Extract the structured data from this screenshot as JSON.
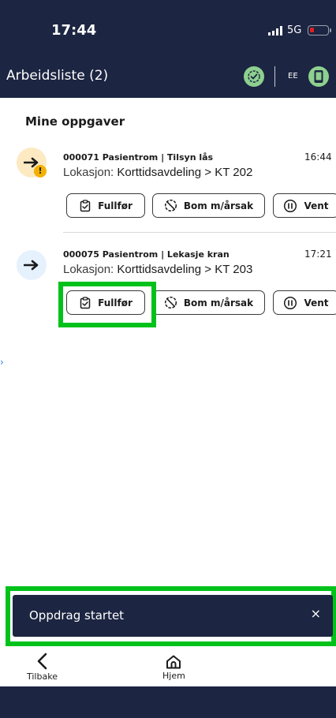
{
  "status_bar": {
    "time": "17:44",
    "network": "5G",
    "battery_color": "#e02020"
  },
  "header": {
    "title": "Arbeidsliste (2)",
    "user_initials": "EE",
    "sync_icon": "sync-check-icon",
    "device_icon": "device-icon",
    "background_color": "#1c2541",
    "status_color": "#8ed08f"
  },
  "section": {
    "title": "Mine oppgaver"
  },
  "tasks": [
    {
      "header": "000071 Pasientrom | Tilsyn lås",
      "time": "16:44",
      "location_prefix": "Lokasjon: ",
      "location": "Korttidsavdeling > KT 202",
      "icon": "arrow-right-icon",
      "icon_bg": "#fde9c2",
      "warning": true,
      "warning_symbol": "!"
    },
    {
      "header": "000075 Pasientrom | Lekasje kran",
      "time": "17:21",
      "location_prefix": "Lokasjon: ",
      "location": "Korttidsavdeling > KT 203",
      "icon": "arrow-right-icon",
      "icon_bg": "#e5f1fd",
      "warning": false
    }
  ],
  "actions": {
    "complete_label": "Fullfør",
    "skip_label": "Bom m/årsak",
    "wait_label": "Vent"
  },
  "toast": {
    "message": "Oppdrag startet",
    "close_symbol": "×"
  },
  "nav": {
    "back_label": "Tilbake",
    "home_label": "Hjem"
  },
  "highlight_color": "#00c21b"
}
